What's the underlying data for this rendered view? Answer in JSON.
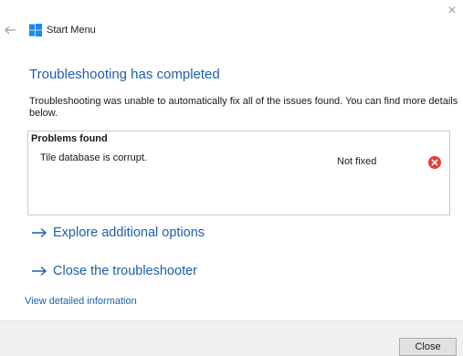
{
  "window": {
    "title": "Start Menu",
    "close_glyph": "×"
  },
  "content": {
    "heading": "Troubleshooting has completed",
    "description": "Troubleshooting was unable to automatically fix all of the issues found. You can find more details below."
  },
  "problems": {
    "title": "Problems found",
    "items": [
      {
        "text": "Tile database is corrupt.",
        "status": "Not fixed",
        "icon": "error-icon"
      }
    ]
  },
  "links": {
    "explore": "Explore additional options",
    "close_troubleshooter": "Close the troubleshooter",
    "view_details": "View detailed information"
  },
  "footer": {
    "close_button": "Close"
  },
  "colors": {
    "accent": "#1e5fa8",
    "error": "#e0413a",
    "footer_bg": "#f0f0f0"
  }
}
